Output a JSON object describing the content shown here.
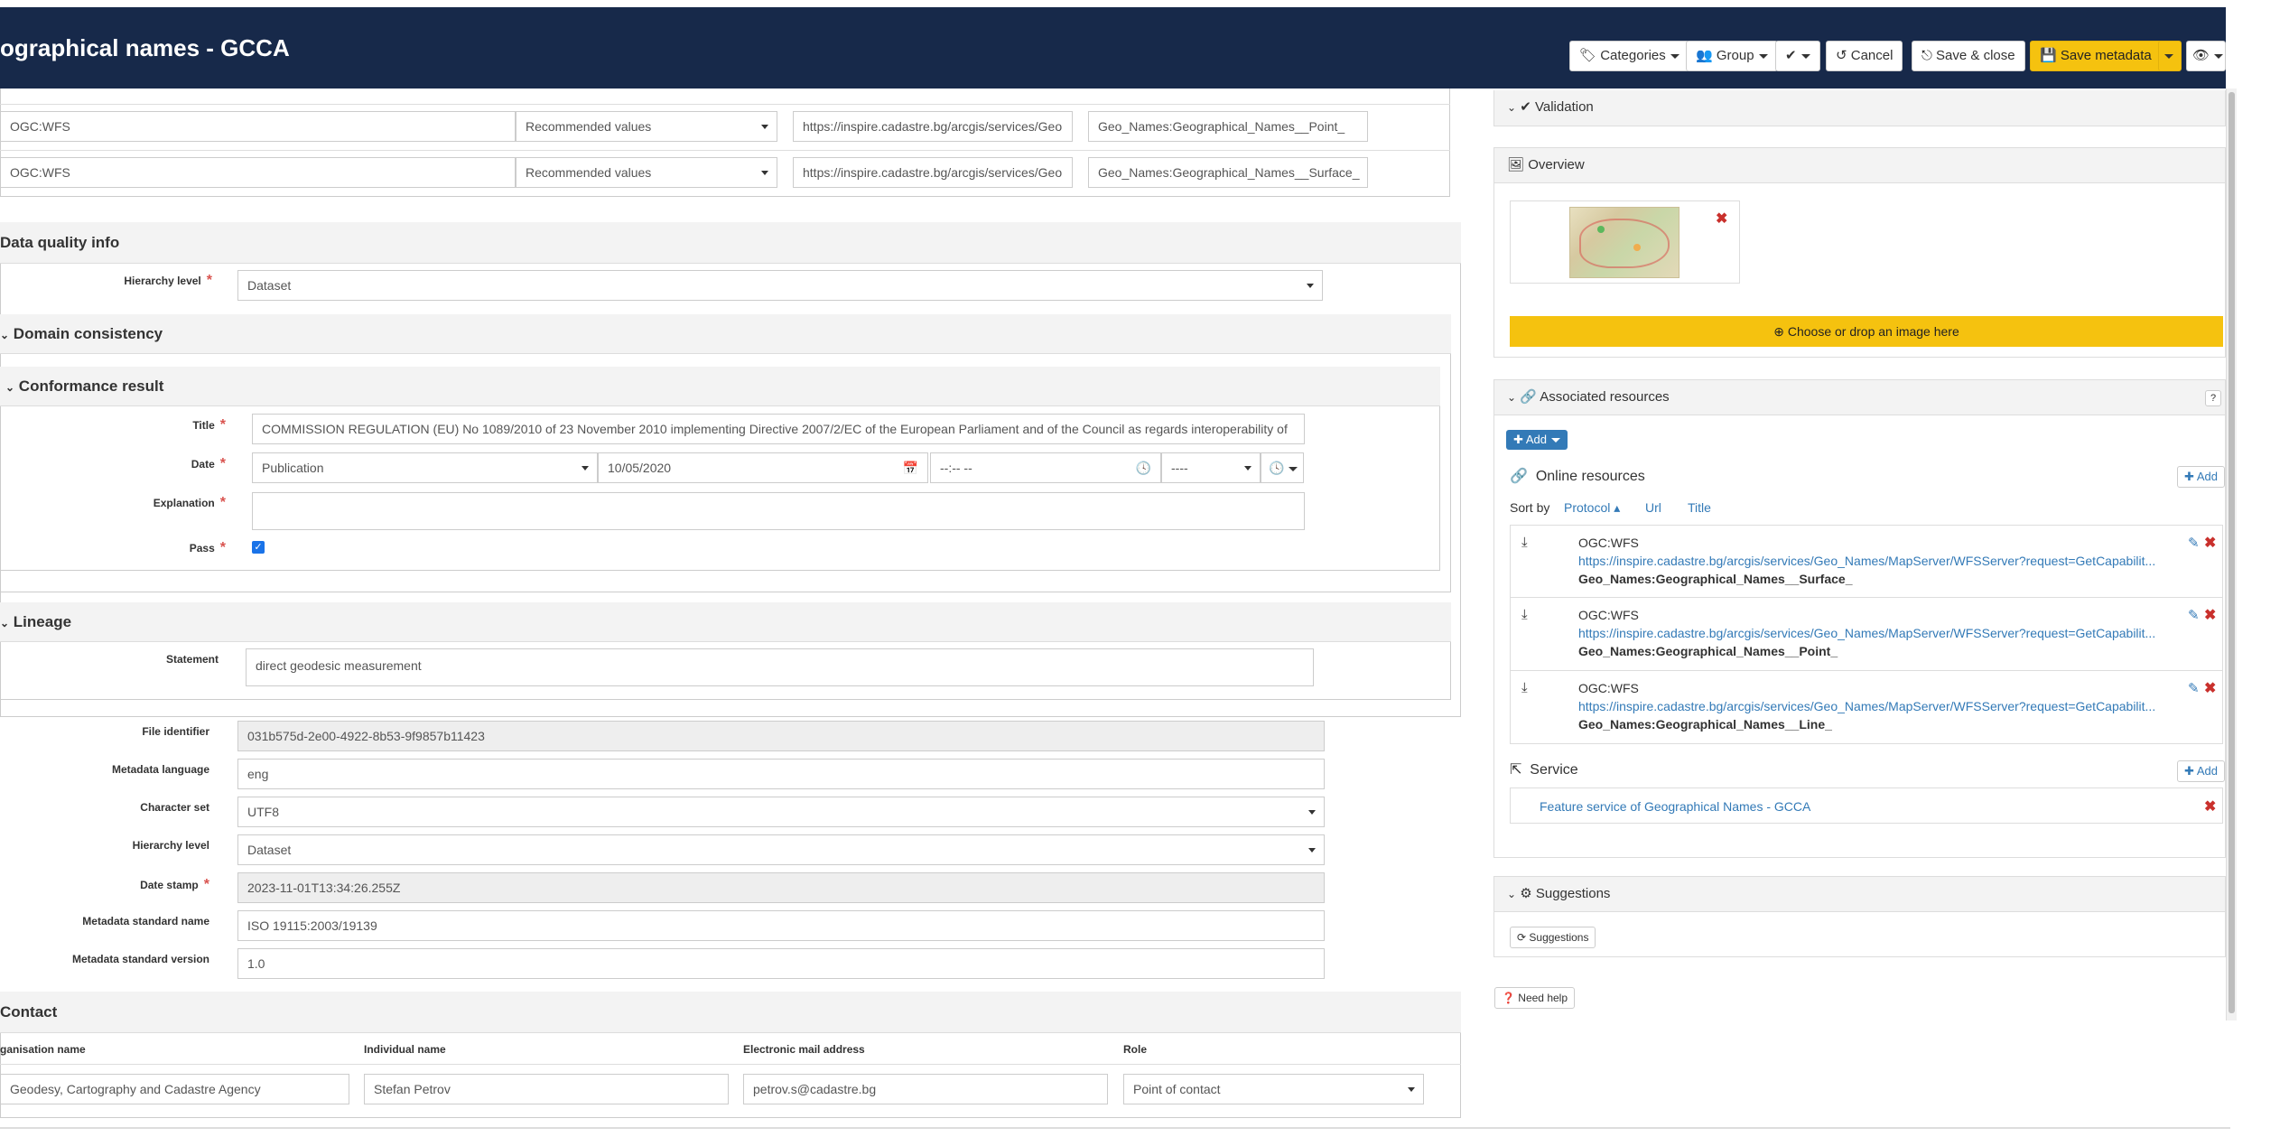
{
  "header": {
    "title": "ographical names - GCCA",
    "buttons": {
      "categories": "Categories",
      "group": "Group",
      "check": "✔",
      "cancel": "Cancel",
      "save_close": "Save & close",
      "save_metadata": "Save metadata",
      "view": "👁"
    }
  },
  "distribution_rows": [
    {
      "protocol": "OGC:WFS",
      "values": "Recommended values",
      "url": "https://inspire.cadastre.bg/arcgis/services/Geo",
      "name": "Geo_Names:Geographical_Names__Point_"
    },
    {
      "protocol": "OGC:WFS",
      "values": "Recommended values",
      "url": "https://inspire.cadastre.bg/arcgis/services/Geo",
      "name": "Geo_Names:Geographical_Names__Surface_"
    }
  ],
  "data_quality": {
    "title": "Data quality info",
    "hierarchy_level_label": "Hierarchy level",
    "hierarchy_level_value": "Dataset",
    "domain_consistency": "Domain consistency",
    "conformance_result": "Conformance result",
    "title_label": "Title",
    "title_value": "COMMISSION REGULATION (EU) No 1089/2010 of 23 November 2010 implementing Directive 2007/2/EC of the European Parliament and of the Council as regards interoperability of",
    "date_label": "Date",
    "date_type": "Publication",
    "date_value": "10/05/2020",
    "time_value": "--:-- --",
    "tz_value": "----",
    "explanation_label": "Explanation",
    "pass_label": "Pass"
  },
  "lineage": {
    "title": "Lineage",
    "statement_label": "Statement",
    "statement_value": "direct geodesic measurement"
  },
  "metadata": {
    "file_identifier_label": "File identifier",
    "file_identifier_value": "031b575d-2e00-4922-8b53-9f9857b11423",
    "language_label": "Metadata language",
    "language_value": "eng",
    "charset_label": "Character set",
    "charset_value": "UTF8",
    "hierarchy_label": "Hierarchy level",
    "hierarchy_value": "Dataset",
    "datestamp_label": "Date stamp",
    "datestamp_value": "2023-11-01T13:34:26.255Z",
    "std_name_label": "Metadata standard name",
    "std_name_value": "ISO 19115:2003/19139",
    "std_version_label": "Metadata standard version",
    "std_version_value": "1.0"
  },
  "contact": {
    "title": "Contact",
    "headers": [
      "ganisation name",
      "Individual name",
      "Electronic mail address",
      "Role"
    ],
    "org_value": "Geodesy, Cartography and Cadastre Agency",
    "individual_value": "Stefan Petrov",
    "email_value": "petrov.s@cadastre.bg",
    "role_value": "Point of contact"
  },
  "sidebar": {
    "validation": "Validation",
    "overview": "Overview",
    "choose_image": "Choose or drop an image here",
    "associated": "Associated resources",
    "add": "Add",
    "online_resources": "Online resources",
    "sort_by": "Sort by",
    "sort_protocol": "Protocol",
    "sort_url": "Url",
    "sort_title": "Title",
    "resources": [
      {
        "protocol": "OGC:WFS",
        "url": "https://inspire.cadastre.bg/arcgis/services/Geo_Names/MapServer/WFSServer?request=GetCapabilit...",
        "name": "Geo_Names:Geographical_Names__Surface_"
      },
      {
        "protocol": "OGC:WFS",
        "url": "https://inspire.cadastre.bg/arcgis/services/Geo_Names/MapServer/WFSServer?request=GetCapabilit...",
        "name": "Geo_Names:Geographical_Names__Point_"
      },
      {
        "protocol": "OGC:WFS",
        "url": "https://inspire.cadastre.bg/arcgis/services/Geo_Names/MapServer/WFSServer?request=GetCapabilit...",
        "name": "Geo_Names:Geographical_Names__Line_"
      }
    ],
    "service": "Service",
    "service_link": "Feature service of Geographical Names - GCCA",
    "suggestions": "Suggestions",
    "suggestions_btn": "Suggestions",
    "need_help": "Need help"
  },
  "colors": {
    "header_bg": "#17294a",
    "accent_yellow": "#f5c20f",
    "link_blue": "#337ab7",
    "delete_red": "#c9302c"
  }
}
